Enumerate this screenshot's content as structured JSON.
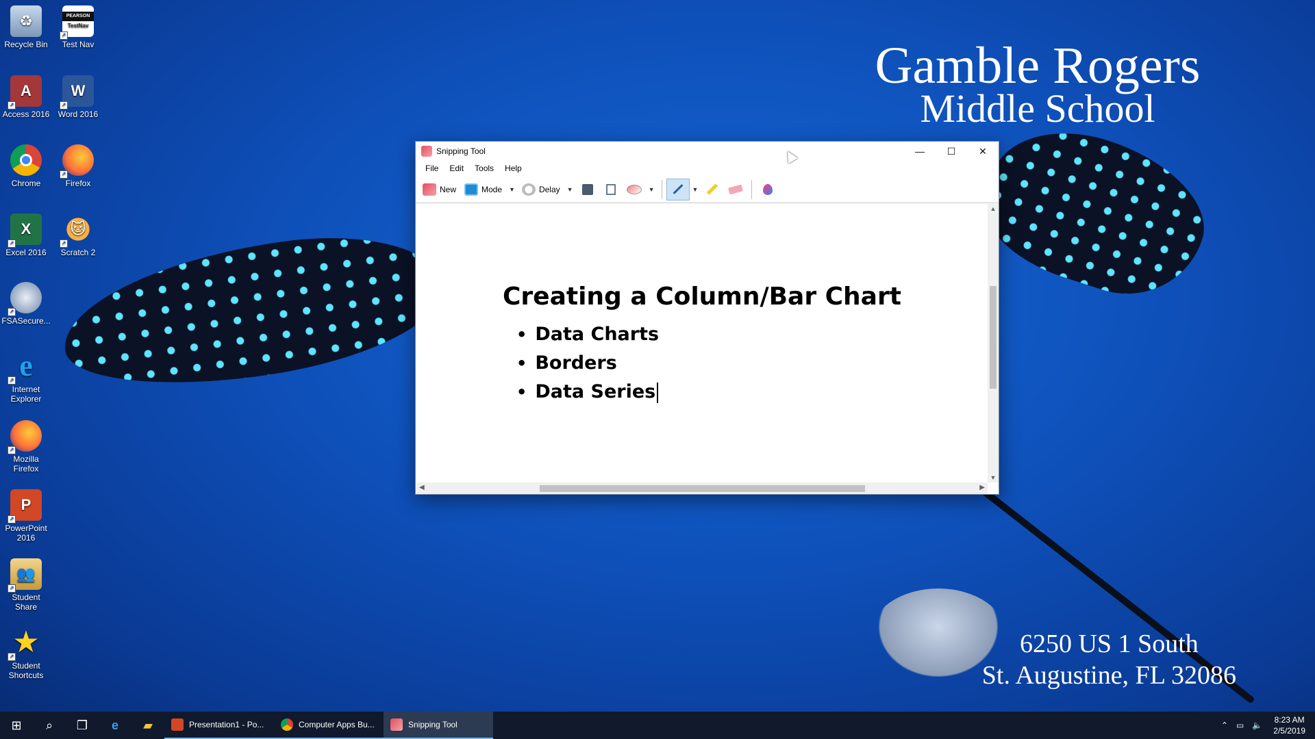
{
  "wallpaper": {
    "school_line1": "Gamble Rogers",
    "school_line2": "Middle School",
    "address_line1": "6250 US 1 South",
    "address_line2": "St. Augustine, FL 32086"
  },
  "desktop_icons": [
    {
      "label": "Recycle Bin",
      "icon": "recycle-bin-icon"
    },
    {
      "label": "Test Nav",
      "icon": "testnav-icon",
      "badge": "PEARSON"
    },
    {
      "label": "Access 2016",
      "icon": "access-icon"
    },
    {
      "label": "Word 2016",
      "icon": "word-icon"
    },
    {
      "label": "Chrome",
      "icon": "chrome-icon"
    },
    {
      "label": "Firefox",
      "icon": "firefox-icon"
    },
    {
      "label": "Excel 2016",
      "icon": "excel-icon"
    },
    {
      "label": "Scratch 2",
      "icon": "scratch-icon"
    },
    {
      "label": "FSASecure...",
      "icon": "fsasecure-icon"
    },
    {
      "label": "Internet Explorer",
      "icon": "internet-explorer-icon"
    },
    {
      "label": "Mozilla Firefox",
      "icon": "firefox-icon"
    },
    {
      "label": "PowerPoint 2016",
      "icon": "powerpoint-icon"
    },
    {
      "label": "Student Share",
      "icon": "student-share-icon"
    },
    {
      "label": "Student Shortcuts",
      "icon": "star-icon"
    }
  ],
  "window": {
    "title": "Snipping Tool",
    "menu": [
      "File",
      "Edit",
      "Tools",
      "Help"
    ],
    "toolbar": {
      "new_label": "New",
      "mode_label": "Mode",
      "delay_label": "Delay"
    }
  },
  "slide": {
    "title": "Creating a Column/Bar Chart",
    "bullets": [
      "Data Charts",
      "Borders",
      "Data Series"
    ]
  },
  "taskbar": {
    "tasks": [
      {
        "label": "Presentation1 - Po...",
        "icon": "powerpoint-icon"
      },
      {
        "label": "Computer Apps Bu...",
        "icon": "chrome-icon"
      },
      {
        "label": "Snipping Tool",
        "icon": "snipping-tool-icon"
      }
    ],
    "time": "8:23 AM",
    "date": "2/5/2019"
  },
  "colors": {
    "word": "#2b579a",
    "excel": "#217346",
    "powerpoint": "#d24726",
    "access": "#a4373a",
    "taskbar": "#101a2c",
    "accent": "#76b9ed"
  }
}
